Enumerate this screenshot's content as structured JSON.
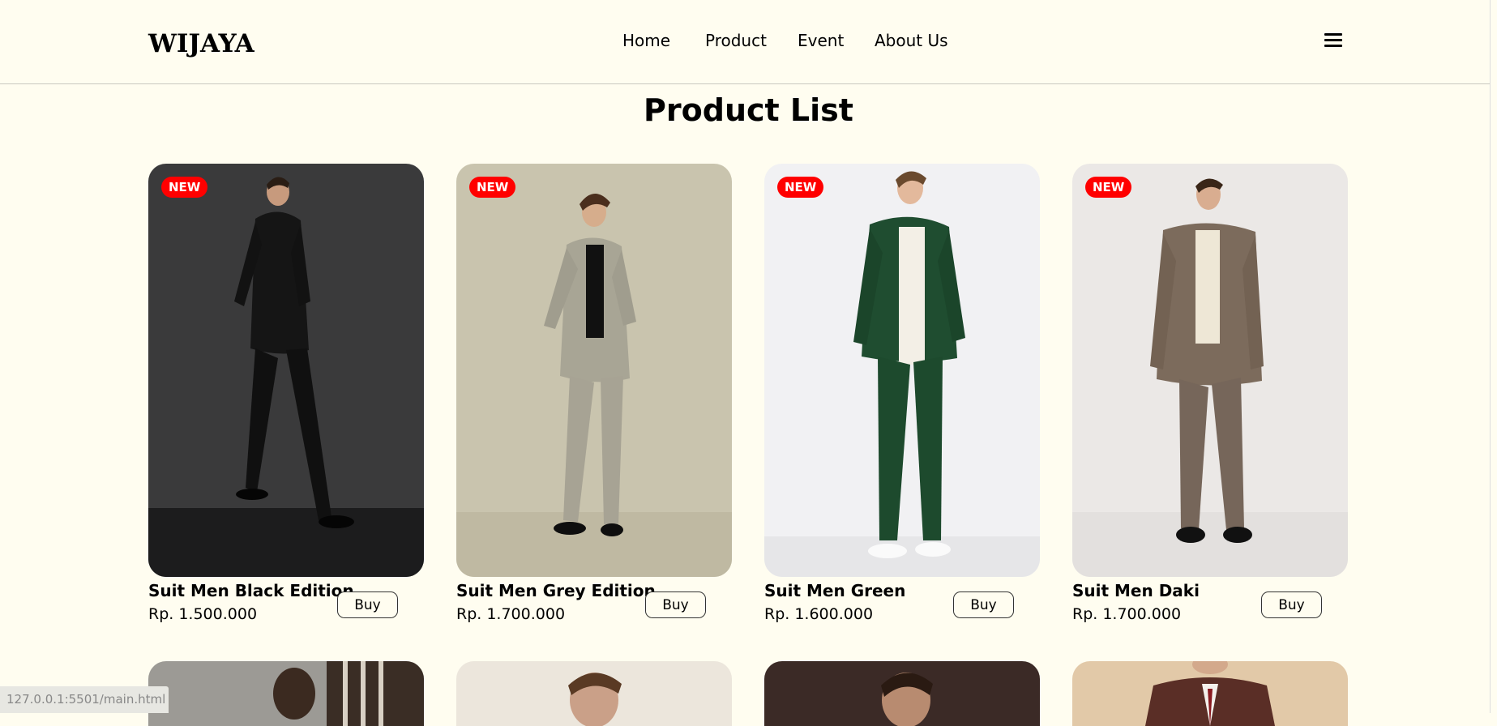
{
  "brand": "WIJAYA",
  "nav": {
    "items": [
      "Home",
      "Product",
      "Event",
      "About Us"
    ],
    "menu_icon": "hamburger-icon"
  },
  "page_title": "Product List",
  "products": [
    {
      "name": "Suit Men Black Edition",
      "price": "Rp. 1.500.000",
      "badge": "NEW",
      "buy": "Buy"
    },
    {
      "name": "Suit Men Grey Edition",
      "price": "Rp. 1.700.000",
      "badge": "NEW",
      "buy": "Buy"
    },
    {
      "name": "Suit Men Green",
      "price": "Rp. 1.600.000",
      "badge": "NEW",
      "buy": "Buy"
    },
    {
      "name": "Suit Men Daki",
      "price": "Rp. 1.700.000",
      "badge": "NEW",
      "buy": "Buy"
    }
  ],
  "status_url": "127.0.0.1:5501/main.html",
  "colors": {
    "background": "#fffdf0",
    "badge": "#ff0000"
  }
}
